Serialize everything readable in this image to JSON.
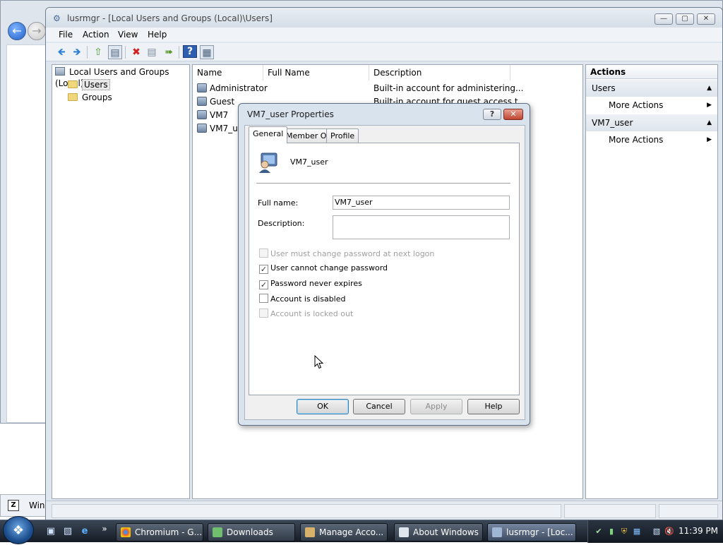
{
  "main_window": {
    "title": "lusrmgr - [Local Users and Groups (Local)\\Users]",
    "menu": [
      "File",
      "Action",
      "View",
      "Help"
    ]
  },
  "tree": {
    "root": "Local Users and Groups (Local)",
    "items": [
      "Users",
      "Groups"
    ],
    "selected": "Users"
  },
  "list": {
    "columns": [
      "Name",
      "Full Name",
      "Description"
    ],
    "rows": [
      {
        "name": "Administrator",
        "full_name": "",
        "description": "Built-in account for administering..."
      },
      {
        "name": "Guest",
        "full_name": "",
        "description": "Built-in account for guest access t..."
      },
      {
        "name": "VM7",
        "full_name": "",
        "description": ""
      },
      {
        "name": "VM7_us",
        "full_name": "",
        "description": ""
      }
    ]
  },
  "actions": {
    "title": "Actions",
    "sections": [
      {
        "label": "Users",
        "items": [
          "More Actions"
        ]
      },
      {
        "label": "VM7_user",
        "items": [
          "More Actions"
        ]
      }
    ]
  },
  "dialog": {
    "title": "VM7_user Properties",
    "tabs": [
      "General",
      "Member Of",
      "Profile"
    ],
    "selected_tab": "General",
    "user_name": "VM7_user",
    "full_name_label": "Full name:",
    "full_name_value": "VM7_user",
    "description_label": "Description:",
    "description_value": "",
    "checkboxes": [
      {
        "label": "User must change password at next logon",
        "checked": false,
        "enabled": false
      },
      {
        "label": "User cannot change password",
        "checked": true,
        "enabled": true
      },
      {
        "label": "Password never expires",
        "checked": true,
        "enabled": true
      },
      {
        "label": "Account is disabled",
        "checked": false,
        "enabled": true
      },
      {
        "label": "Account is locked out",
        "checked": false,
        "enabled": false
      }
    ],
    "buttons": {
      "ok": "OK",
      "cancel": "Cancel",
      "apply": "Apply",
      "help": "Help"
    }
  },
  "background_window": {
    "task_label": "Win"
  },
  "taskbar": {
    "tasks": [
      "Chromium - G...",
      "Downloads",
      "Manage Acco...",
      "About Windows",
      "lusrmgr - [Loc..."
    ],
    "active_task": "lusrmgr - [Loc...",
    "clock": "11:39 PM",
    "quicklaunch_more": "»"
  },
  "colors": {
    "accent": "#3c7fb1",
    "window_frame": "#dfe6ee",
    "taskbar": "#1b2330"
  }
}
